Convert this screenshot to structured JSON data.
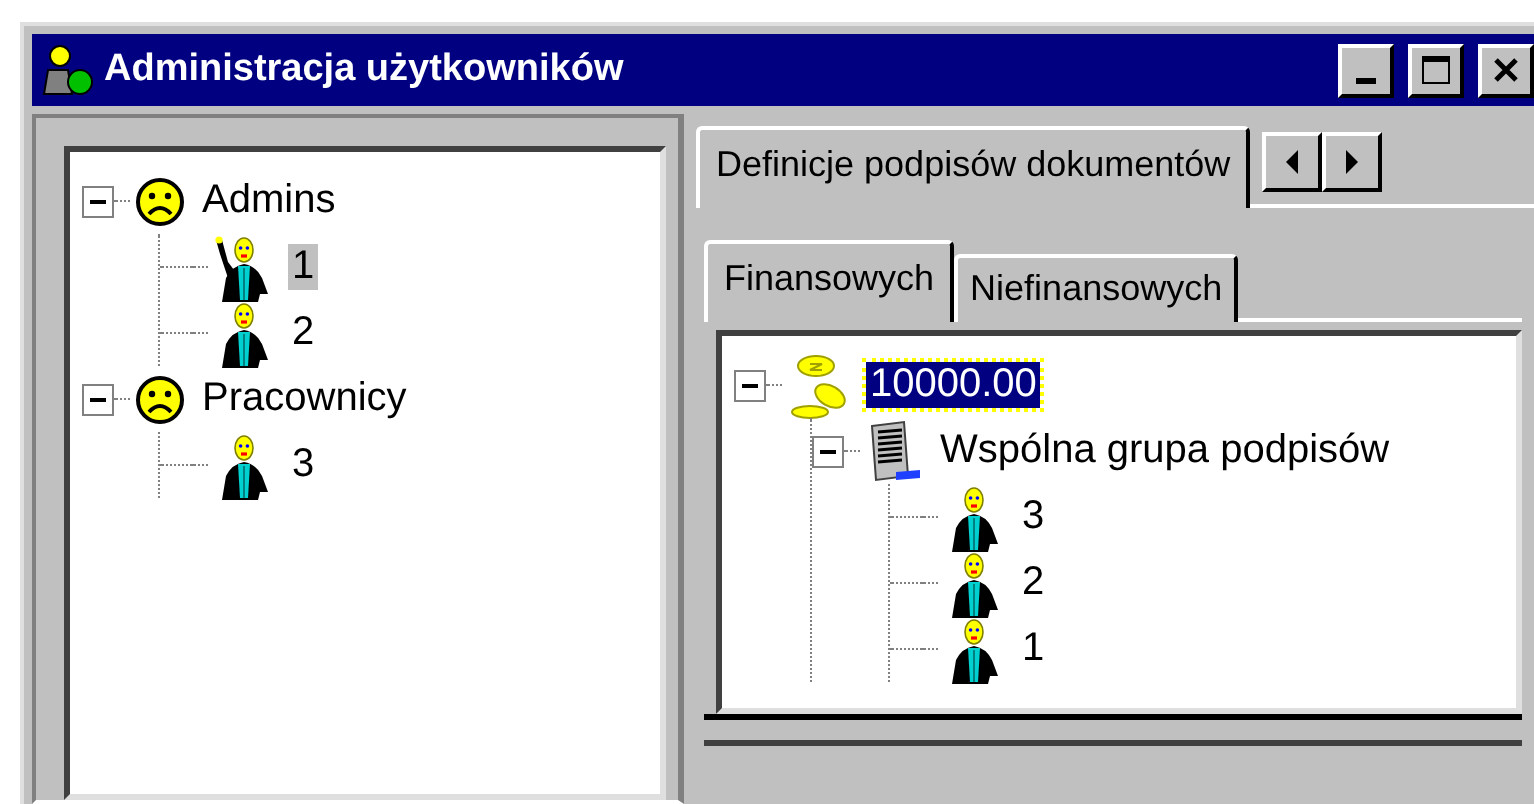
{
  "window": {
    "title": "Administracja użytkowników"
  },
  "user_tree": {
    "focused": false,
    "items": [
      {
        "kind": "group",
        "label": "Admins",
        "selected": false,
        "expanded": true,
        "children": [
          {
            "kind": "user",
            "label": "1",
            "selected": true
          },
          {
            "kind": "user",
            "label": "2",
            "selected": false
          }
        ]
      },
      {
        "kind": "group",
        "label": "Pracownicy",
        "selected": false,
        "expanded": true,
        "children": [
          {
            "kind": "user",
            "label": "3",
            "selected": false
          }
        ]
      }
    ]
  },
  "tabs": [
    {
      "label": "Definicje podpisów dokumentów",
      "selected": true
    }
  ],
  "subtabs": [
    {
      "label": "Finansowych",
      "selected": true
    },
    {
      "label": "Niefinansowych",
      "selected": false
    }
  ],
  "signature_tree": {
    "focused": true,
    "items": [
      {
        "kind": "amount",
        "label": "10000.00",
        "selected": true,
        "expanded": true,
        "children": [
          {
            "kind": "signature-group",
            "label": "Wspólna grupa podpisów",
            "selected": false,
            "expanded": true,
            "children": [
              {
                "kind": "user",
                "label": "3",
                "selected": false
              },
              {
                "kind": "user",
                "label": "2",
                "selected": false
              },
              {
                "kind": "user",
                "label": "1",
                "selected": false
              }
            ]
          }
        ]
      }
    ]
  }
}
